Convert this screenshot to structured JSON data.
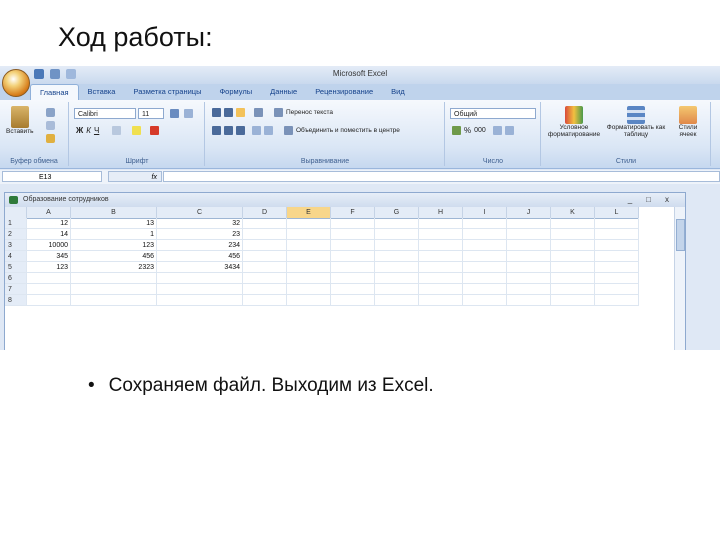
{
  "slide": {
    "title": "Ход работы:",
    "bullet": "Сохраняем файл. Выходим из Excel."
  },
  "excel": {
    "app_title": "Microsoft Excel",
    "tabs": [
      "Главная",
      "Вставка",
      "Разметка страницы",
      "Формулы",
      "Данные",
      "Рецензирование",
      "Вид"
    ],
    "ribbon": {
      "paste_label": "Вставить",
      "font_name": "Calibri",
      "font_size": "11",
      "bold": "Ж",
      "italic": "К",
      "underline": "Ч",
      "wrap_text": "Перенос текста",
      "merge_center": "Объединить и поместить в центре",
      "number_format": "Общий",
      "percent": "%",
      "thousands": "000",
      "conditional_format": "Условное форматирование",
      "format_as_table": "Форматировать как таблицу",
      "cell_styles": "Стили ячеек",
      "group_clipboard": "Буфер обмена",
      "group_font": "Шрифт",
      "group_alignment": "Выравнивание",
      "group_number": "Число",
      "group_styles": "Стили"
    },
    "name_box": "E13",
    "fx": "fx",
    "workbook_title": "Образование сотрудников",
    "window_controls": [
      "_",
      "□",
      "x"
    ],
    "columns": [
      "A",
      "B",
      "C",
      "D",
      "E",
      "F",
      "G",
      "H",
      "I",
      "J",
      "K",
      "L"
    ],
    "selected_column": "E",
    "rows": [
      {
        "n": "1",
        "cells": [
          "12",
          "13",
          "32"
        ]
      },
      {
        "n": "2",
        "cells": [
          "14",
          "1",
          "23"
        ]
      },
      {
        "n": "3",
        "cells": [
          "10000",
          "123",
          "234"
        ]
      },
      {
        "n": "4",
        "cells": [
          "345",
          "456",
          "456"
        ]
      },
      {
        "n": "5",
        "cells": [
          "123",
          "2323",
          "3434"
        ]
      },
      {
        "n": "6",
        "cells": [
          "",
          "",
          ""
        ]
      },
      {
        "n": "7",
        "cells": [
          "",
          "",
          ""
        ]
      },
      {
        "n": "8",
        "cells": [
          "",
          "",
          ""
        ]
      }
    ],
    "colors": {
      "selected_header": "#f8d68a",
      "ribbon": "#dae6f5",
      "tab_text": "#15428b"
    }
  }
}
